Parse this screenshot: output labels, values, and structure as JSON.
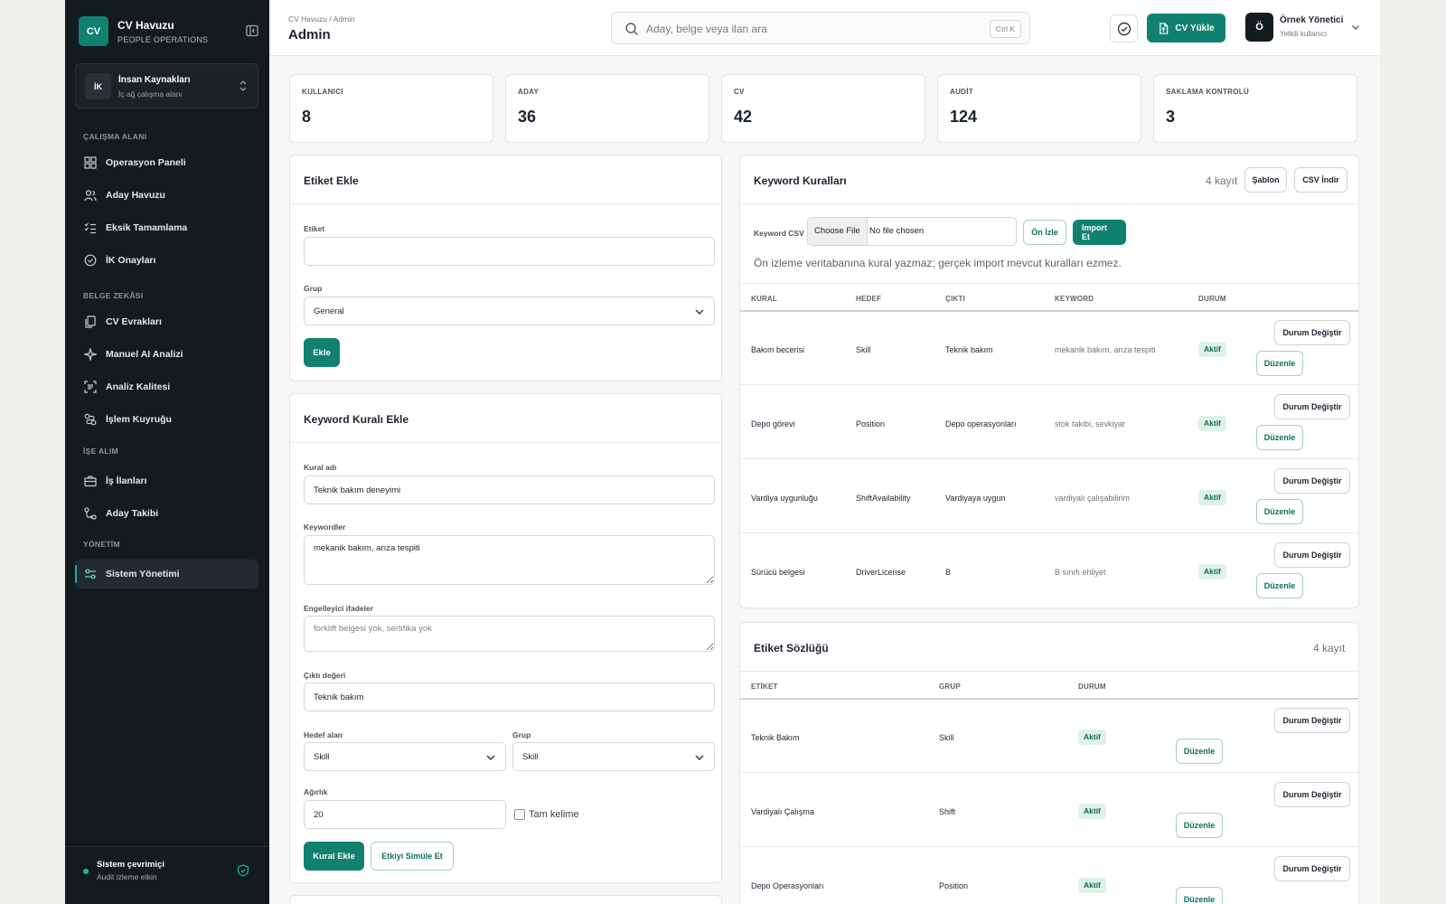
{
  "brand": {
    "name": "CV Havuzu",
    "subtitle": "PEOPLE OPERATIONS",
    "logo": "CV"
  },
  "workspace": {
    "badge": "İK",
    "name": "İnsan Kaynakları",
    "subtitle": "İç ağ çalışma alanı"
  },
  "nav": {
    "section_workspace": "ÇALIŞMA ALANI",
    "section_docs": "BELGE ZEKÂSI",
    "section_hiring": "İŞE ALIM",
    "section_admin": "YÖNETİM",
    "items": [
      {
        "label": "Operasyon Paneli",
        "icon": "grid-icon"
      },
      {
        "label": "Aday Havuzu",
        "icon": "users-icon"
      },
      {
        "label": "Eksik Tamamlama",
        "icon": "checklist-icon"
      },
      {
        "label": "İK Onayları",
        "icon": "check-circle-icon"
      },
      {
        "label": "CV Evrakları",
        "icon": "documents-icon"
      },
      {
        "label": "Manuel AI Analizi",
        "icon": "sparkle-icon"
      },
      {
        "label": "Analiz Kalitesi",
        "icon": "scan-icon"
      },
      {
        "label": "İşlem Kuyruğu",
        "icon": "queue-icon"
      },
      {
        "label": "İş İlanları",
        "icon": "briefcase-icon"
      },
      {
        "label": "Aday Takibi",
        "icon": "flow-icon"
      },
      {
        "label": "Sistem Yönetimi",
        "icon": "sliders-icon"
      }
    ]
  },
  "footer": {
    "title": "Sistem çevrimiçi",
    "subtitle": "Audit izleme etkin"
  },
  "topbar": {
    "breadcrumb": "CV Havuzu / Admin",
    "title": "Admin",
    "search_placeholder": "Aday, belge veya ilan ara",
    "shortcut": "Ctrl K",
    "upload_label": "CV Yükle",
    "user_initial": "Ö",
    "user_name": "Örnek Yönetici",
    "user_role": "Yetkili kullanıcı"
  },
  "stats": [
    {
      "label": "KULLANICI",
      "value": "8"
    },
    {
      "label": "ADAY",
      "value": "36"
    },
    {
      "label": "CV",
      "value": "42"
    },
    {
      "label": "AUDİT",
      "value": "124"
    },
    {
      "label": "SAKLAMA KONTROLÜ",
      "value": "3"
    }
  ],
  "tag_form": {
    "title": "Etiket Ekle",
    "tag_label": "Etiket",
    "tag_value": "",
    "group_label": "Grup",
    "group_value": "General",
    "submit": "Ekle"
  },
  "rule_form": {
    "title": "Keyword Kuralı Ekle",
    "name_label": "Kural adı",
    "name_value": "Teknik bakım deneyimi",
    "keywords_label": "Keywordler",
    "keywords_value": "mekanik bakım, arıza tespiti",
    "blockers_label": "Engelleyici ifadeler",
    "blockers_placeholder": "forklift belgesi yok, sertifika yok",
    "output_label": "Çıktı değeri",
    "output_value": "Teknik bakım",
    "target_label": "Hedef alan",
    "target_value": "Skill",
    "group_label": "Grup",
    "group_value": "Skill",
    "weight_label": "Ağırlık",
    "weight_value": "20",
    "exact_label": "Tam kelime",
    "submit": "Kural Ekle",
    "simulate": "Etkiyi Simüle Et"
  },
  "rules": {
    "title": "Keyword Kuralları",
    "count": "4 kayıt",
    "template_btn": "Şablon",
    "csv_btn": "CSV İndir",
    "csv_label": "Keyword CSV",
    "choose_file": "Choose File",
    "no_file": "No file chosen",
    "preview_btn": "Ön İzle",
    "import_btn": "Import Et",
    "note": "Ön izleme veritabanına kural yazmaz; gerçek import mevcut kuralları ezmez.",
    "columns": [
      "KURAL",
      "HEDEF",
      "ÇIKTI",
      "KEYWORD",
      "DURUM"
    ],
    "rows": [
      {
        "rule": "Bakım becerisi",
        "target": "Skill",
        "output": "Teknik bakım",
        "keyword": "mekanik bakım, arıza tespiti",
        "status": "Aktif"
      },
      {
        "rule": "Depo görevi",
        "target": "Position",
        "output": "Depo operasyonları",
        "keyword": "stok takibi, sevkiyat",
        "status": "Aktif"
      },
      {
        "rule": "Vardiya uygunluğu",
        "target": "ShiftAvailability",
        "output": "Vardiyaya uygun",
        "keyword": "vardiyalı çalışabilirim",
        "status": "Aktif"
      },
      {
        "rule": "Sürücü belgesi",
        "target": "DriverLicense",
        "output": "B",
        "keyword": "B sınıfı ehliyet",
        "status": "Aktif"
      }
    ],
    "toggle_btn": "Durum Değiştir",
    "edit_btn": "Düzenle"
  },
  "tags": {
    "title": "Etiket Sözlüğü",
    "count": "4 kayıt",
    "columns": [
      "ETİKET",
      "GRUP",
      "DURUM"
    ],
    "rows": [
      {
        "tag": "Teknik Bakım",
        "group": "Skill",
        "status": "Aktif"
      },
      {
        "tag": "Vardiyalı Çalışma",
        "group": "Shift",
        "status": "Aktif"
      },
      {
        "tag": "Depo Operasyonları",
        "group": "Position",
        "status": "Aktif"
      }
    ],
    "toggle_btn": "Durum Değiştir",
    "edit_btn": "Düzenle"
  },
  "colors": {
    "accent": "#11816f",
    "sidebar": "#141b1f",
    "badge_bg": "#dff2e8",
    "badge_text": "#0f6b4f"
  }
}
